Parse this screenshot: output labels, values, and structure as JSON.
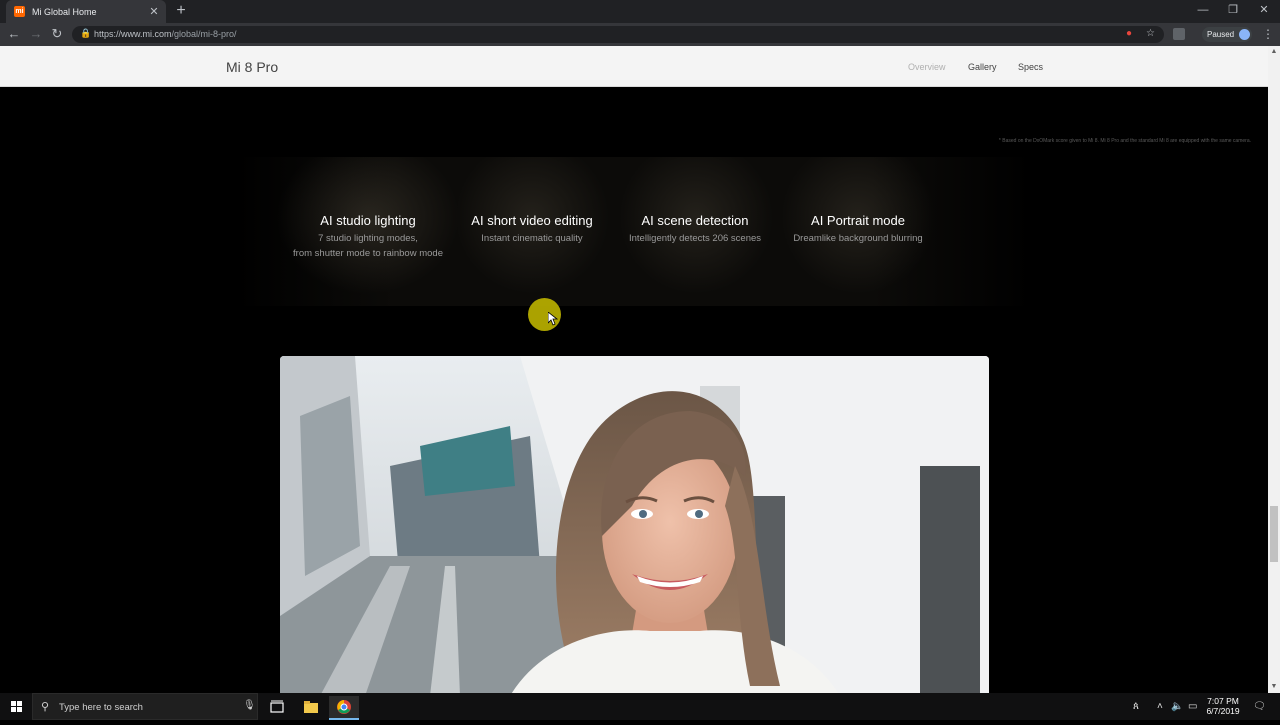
{
  "browser": {
    "tab_title": "Mi Global Home",
    "favicon_text": "mi",
    "url_host": "https://www.mi.com",
    "url_path": "/global/mi-8-pro/",
    "profile_status": "Paused"
  },
  "subnav": {
    "product_name": "Mi 8 Pro",
    "links": [
      "Overview",
      "Gallery",
      "Specs"
    ]
  },
  "footnote": "* Based on the DxOMark score given to Mi 8. Mi 8 Pro and the standard Mi 8 are equipped with the same camera.",
  "features": [
    {
      "title": "AI studio lighting",
      "desc": "7 studio lighting modes,\nfrom shutter mode to rainbow mode"
    },
    {
      "title": "AI short video editing",
      "desc": "Instant cinematic quality"
    },
    {
      "title": "AI scene detection",
      "desc": "Intelligently detects 206 scenes"
    },
    {
      "title": "AI Portrait mode",
      "desc": "Dreamlike background blurring"
    }
  ],
  "taskbar": {
    "search_placeholder": "Type here to search",
    "time": "7:07 PM",
    "date": "6/7/2019"
  },
  "colors": {
    "accent_mi": "#ff6700",
    "cursor_highlight": "#beb400"
  }
}
